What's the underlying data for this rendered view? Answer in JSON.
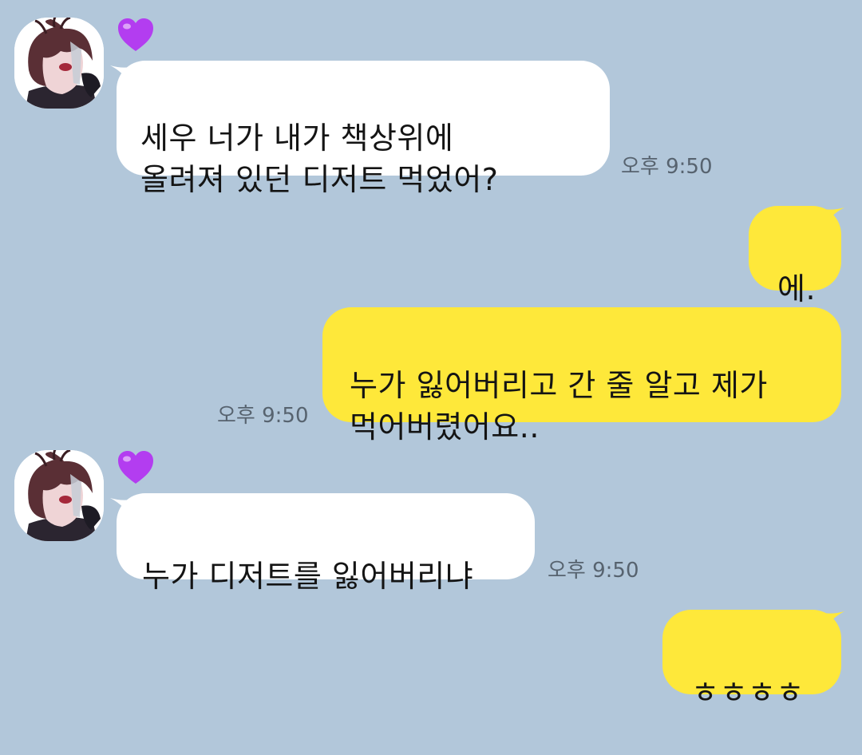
{
  "chat": {
    "colors": {
      "background": "#b2c7da",
      "incoming_bubble": "#ffffff",
      "outgoing_bubble": "#fee83a",
      "heart": "#b33df0",
      "time_text": "#57636f"
    },
    "messages": [
      {
        "direction": "incoming",
        "text": "세우 너가 내가 책상위에\n올려져 있던 디저트 먹었어?",
        "time": "오후 9:50",
        "show_avatar": true,
        "badge_icon": "purple-heart-icon"
      },
      {
        "direction": "outgoing",
        "text": "에.",
        "time": ""
      },
      {
        "direction": "outgoing",
        "text": "누가 잃어버리고 간 줄 알고 제가\n먹어버렸어요..",
        "time": "오후 9:50"
      },
      {
        "direction": "incoming",
        "text": "누가 디저트를 잃어버리냐",
        "time": "오후 9:50",
        "show_avatar": true,
        "badge_icon": "purple-heart-icon"
      },
      {
        "direction": "outgoing",
        "text": "ㅎㅎㅎㅎ",
        "time": ""
      }
    ]
  }
}
